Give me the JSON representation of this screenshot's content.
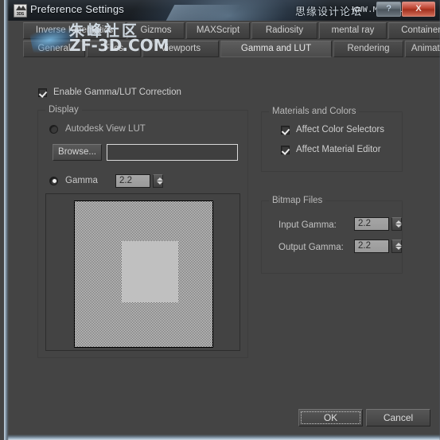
{
  "window": {
    "title": "Preference Settings",
    "app_icon": "3ds-max-icon",
    "help_button": "?",
    "close_button": "X"
  },
  "watermarks": {
    "title_cn": "思缘设计论坛",
    "title_url": "WWW.MISSYUAN.COM",
    "body_cn": "朱峰社区",
    "body_url": "ZF-3D.COM"
  },
  "tabs": {
    "row1": [
      {
        "label": "Inverse Kinematics",
        "selected": false
      },
      {
        "label": "Gizmos",
        "selected": false
      },
      {
        "label": "MAXScript",
        "selected": false
      },
      {
        "label": "Radiosity",
        "selected": false
      },
      {
        "label": "mental ray",
        "selected": false
      },
      {
        "label": "Containers",
        "selected": false
      }
    ],
    "row2": [
      {
        "label": "General",
        "selected": false
      },
      {
        "label": "Files",
        "selected": false
      },
      {
        "label": "Viewports",
        "selected": false
      },
      {
        "label": "Gamma and LUT",
        "selected": true
      },
      {
        "label": "Rendering",
        "selected": false
      },
      {
        "label": "Animation",
        "selected": false
      }
    ]
  },
  "main": {
    "enable_correction": {
      "label": "Enable Gamma/LUT Correction",
      "checked": true
    },
    "display_group": {
      "title": "Display",
      "lut_radio": {
        "label": "Autodesk View LUT",
        "selected": false
      },
      "browse_button": "Browse...",
      "lut_path_value": "",
      "gamma_radio": {
        "label": "Gamma",
        "selected": true
      },
      "gamma_value": "2.2"
    },
    "materials_group": {
      "title": "Materials and Colors",
      "affect_color_selectors": {
        "label": "Affect Color Selectors",
        "checked": true
      },
      "affect_material_editor": {
        "label": "Affect Material Editor",
        "checked": true
      }
    },
    "bitmap_group": {
      "title": "Bitmap Files",
      "input_gamma_label": "Input Gamma:",
      "input_gamma_value": "2.2",
      "output_gamma_label": "Output Gamma:",
      "output_gamma_value": "2.2"
    },
    "preview": {
      "name": "gamma-test-pattern"
    }
  },
  "footer": {
    "ok_label": "OK",
    "cancel_label": "Cancel"
  },
  "colors": {
    "dialog_bg": "#444444",
    "tab_selected": "#5d5d5d",
    "text": "#cfcfcf",
    "field_value_bg": "#a6a6a6",
    "close_button": "#b83c28"
  }
}
